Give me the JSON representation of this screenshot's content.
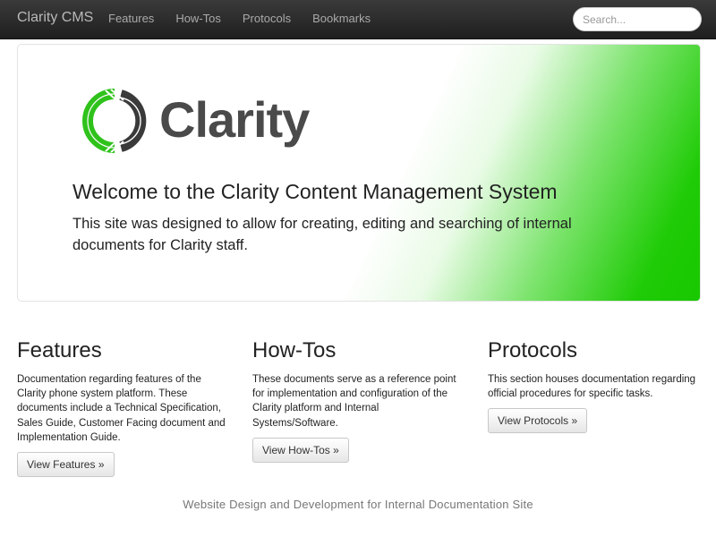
{
  "navbar": {
    "brand": "Clarity CMS",
    "links": [
      "Features",
      "How-Tos",
      "Protocols",
      "Bookmarks"
    ],
    "search_placeholder": "Search..."
  },
  "hero": {
    "logo_text": "Clarity",
    "title": "Welcome to the Clarity Content Management System",
    "text": "This site was designed to allow for creating, editing and searching of internal documents for Clarity staff."
  },
  "columns": [
    {
      "heading": "Features",
      "text": "Documentation regarding features of the Clarity phone system platform. These documents include a Technical Specification, Sales Guide, Customer Facing document and Implementation Guide.",
      "button": "View Features »"
    },
    {
      "heading": "How-Tos",
      "text": "These documents serve as a reference point for implementation and configuration of the Clarity platform and Internal Systems/Software.",
      "button": "View How-Tos »"
    },
    {
      "heading": "Protocols",
      "text": "This section houses documentation regarding official procedures for specific tasks.",
      "button": "View Protocols »"
    }
  ],
  "footer": {
    "text": "Website Design and Development for Internal Documentation Site"
  },
  "colors": {
    "navbar": "#2b2b2b",
    "accent_green": "#18c800",
    "logo_gray": "#4a4a4a"
  }
}
